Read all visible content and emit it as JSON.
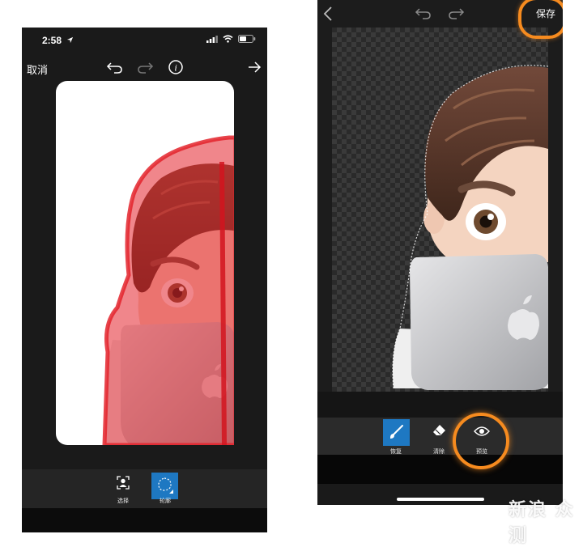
{
  "left": {
    "status": {
      "time": "2:58"
    },
    "nav": {
      "cancel": "取消"
    },
    "toolbar": {
      "select": "选择",
      "outline": "轮廓"
    }
  },
  "right": {
    "nav": {
      "save": "保存"
    },
    "toolbar": {
      "restore": "恢复",
      "erase": "清除",
      "preview": "预览"
    }
  },
  "watermark": "新浪 众测",
  "colors": {
    "highlight_ring": "#f68b1f",
    "selected_tool_bg": "#1e78c2",
    "mask_red": "#e3232c",
    "dark_ui": "#1a1a1a"
  },
  "icons": {
    "location": "location-arrow-icon",
    "signal": "cellular-signal-icon",
    "wifi": "wifi-icon",
    "battery": "battery-icon",
    "undo": "undo-icon",
    "redo": "redo-icon",
    "info": "info-icon",
    "forward": "arrow-right-icon",
    "back": "chevron-left-icon",
    "select": "person-select-icon",
    "outline": "lasso-outline-icon",
    "restore": "brush-icon",
    "erase": "eraser-icon",
    "preview": "eye-icon"
  }
}
